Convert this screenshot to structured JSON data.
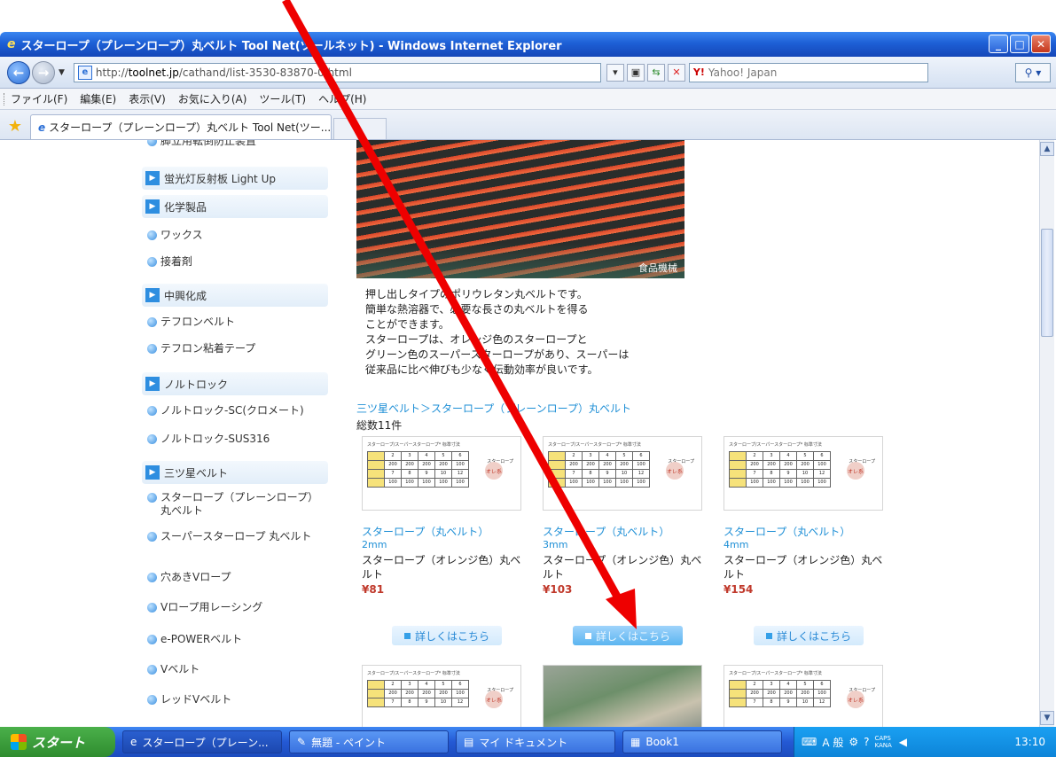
{
  "window": {
    "title": "スターロープ（プレーンロープ）丸ベルト Tool Net(ツールネット) - Windows Internet Explorer",
    "minimize": "_",
    "maximize": "□",
    "close": "✕"
  },
  "address_bar": {
    "url_prefix": "http://",
    "url_domain": "toolnet.jp",
    "url_path": "/cathand/list-3530-83870-0.html",
    "search_placeholder": "Yahoo! Japan",
    "search_logo": "Y!"
  },
  "menu": [
    "ファイル(F)",
    "編集(E)",
    "表示(V)",
    "お気に入り(A)",
    "ツール(T)",
    "ヘルプ(H)"
  ],
  "tab": {
    "label": "スターロープ（プレーンロープ）丸ベルト Tool Net(ツー..."
  },
  "sidebar": {
    "items": [
      {
        "type": "item",
        "label": "脚立用転倒防止装置"
      },
      {
        "type": "head",
        "label": "蛍光灯反射板 Light Up"
      },
      {
        "type": "head",
        "label": "化学製品"
      },
      {
        "type": "item",
        "label": "ワックス"
      },
      {
        "type": "item",
        "label": "接着剤"
      },
      {
        "type": "head",
        "label": "中興化成"
      },
      {
        "type": "item",
        "label": "テフロンベルト"
      },
      {
        "type": "item",
        "label": "テフロン粘着テープ"
      },
      {
        "type": "head",
        "label": "ノルトロック"
      },
      {
        "type": "item",
        "label": "ノルトロック-SC(クロメート)"
      },
      {
        "type": "item",
        "label": "ノルトロック-SUS316"
      },
      {
        "type": "head",
        "label": "三ツ星ベルト"
      },
      {
        "type": "item",
        "label": "スターロープ（プレーンロープ）丸ベルト"
      },
      {
        "type": "item",
        "label": "スーパースターロープ 丸ベルト"
      },
      {
        "type": "item",
        "label": "穴あきVロープ"
      },
      {
        "type": "item",
        "label": "Vロープ用レーシング"
      },
      {
        "type": "item",
        "label": "e-POWERベルト"
      },
      {
        "type": "item",
        "label": "Vベルト"
      },
      {
        "type": "item",
        "label": "レッドVベルト"
      }
    ]
  },
  "main": {
    "hero_label": "食品機械",
    "description": [
      "押し出しタイプのポリウレタン丸ベルトです。",
      "簡単な熱溶器で、必要な長さの丸ベルトを得る",
      "ことができます。",
      "スターロープは、オレンジ色のスターロープと",
      "グリーン色のスーパースターロープがあり、スーパーは",
      "従来品に比べ伸びも少なく伝動効率が良いです。"
    ],
    "breadcrumb": "三ツ星ベルト＞スターロープ（プレーンロープ）丸ベルト",
    "count": "総数11件",
    "detail_label": "詳しくはこちら",
    "thumb_caption": "スターロープ/スーパースターロープ* 标準寸法",
    "thumb_side": "スターロープ",
    "thumb_badge": "オレ系",
    "products": [
      {
        "name": "スターロープ（丸ベルト）",
        "size": "2mm",
        "desc": "スターロープ（オレンジ色）丸ベルト",
        "price": "¥81"
      },
      {
        "name": "スターロープ（丸ベルト）",
        "size": "3mm",
        "desc": "スターロープ（オレンジ色）丸ベルト",
        "price": "¥103"
      },
      {
        "name": "スターロープ（丸ベルト）",
        "size": "4mm",
        "desc": "スターロープ（オレンジ色）丸ベルト",
        "price": "¥154"
      }
    ]
  },
  "taskbar": {
    "start": "スタート",
    "tasks": [
      "スターロープ（プレーン...",
      "無題 - ペイント",
      "マイ ドキュメント",
      "Book1"
    ],
    "tray_ime": "A 般",
    "tray_caps": "CAPS",
    "tray_kana": "KANA",
    "clock": "13:10"
  },
  "colors": {
    "link": "#1e8fd6",
    "price": "#c0392b",
    "annotation_arrow": "#ee0000"
  }
}
